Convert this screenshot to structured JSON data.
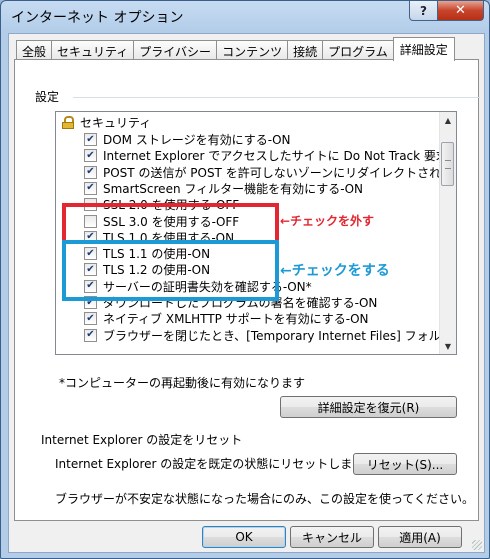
{
  "window": {
    "title": "インターネット オプション",
    "help_label": "?",
    "close_label": "✕"
  },
  "tabs": [
    {
      "label": "全般"
    },
    {
      "label": "セキュリティ"
    },
    {
      "label": "プライバシー"
    },
    {
      "label": "コンテンツ"
    },
    {
      "label": "接続"
    },
    {
      "label": "プログラム"
    },
    {
      "label": "詳細設定"
    }
  ],
  "active_tab": "詳細設定",
  "settings": {
    "group_label": "設定",
    "category": "セキュリティ",
    "items": [
      {
        "label": "DOM ストレージを有効にする-ON",
        "checked": true
      },
      {
        "label": "Internet Explorer でアクセスしたサイトに Do Not Track 要求を送",
        "checked": true
      },
      {
        "label": "POST の送信が POST を許可しないゾーンにリダイレクトされた場合に",
        "checked": true
      },
      {
        "label": "SmartScreen フィルター機能を有効にする-ON",
        "checked": true
      },
      {
        "label": "SSL 2.0 を使用する-OFF",
        "checked": false
      },
      {
        "label": "SSL 3.0 を使用する-OFF",
        "checked": false
      },
      {
        "label": "TLS 1.0 を使用する-ON",
        "checked": true
      },
      {
        "label": "TLS 1.1 の使用-ON",
        "checked": true
      },
      {
        "label": "TLS 1.2 の使用-ON",
        "checked": true
      },
      {
        "label": "サーバーの証明書失効を確認する-ON*",
        "checked": true
      },
      {
        "label": "ダウンロードしたプログラムの署名を確認する-ON",
        "checked": true
      },
      {
        "label": "ネイティブ XMLHTTP サポートを有効にする-ON",
        "checked": true
      },
      {
        "label": "ブラウザーを閉じたとき、[Temporary Internet Files] フォルダーを",
        "checked": true
      }
    ],
    "footnote": "*コンピューターの再起動後に有効になります",
    "restore_button": "詳細設定を復元(R)"
  },
  "annotations": {
    "red_note": "←チェックを外す",
    "blue_note": "←チェックをする",
    "red_color": "#e3262f",
    "blue_color": "#1b9ad6"
  },
  "reset": {
    "title": "Internet Explorer の設定をリセット",
    "description": "Internet Explorer の設定を既定の状態にリセットします。",
    "button": "リセット(S)...",
    "note": "ブラウザーが不安定な状態になった場合にのみ、この設定を使ってください。"
  },
  "footer": {
    "ok": "OK",
    "cancel": "キャンセル",
    "apply": "適用(A)"
  }
}
